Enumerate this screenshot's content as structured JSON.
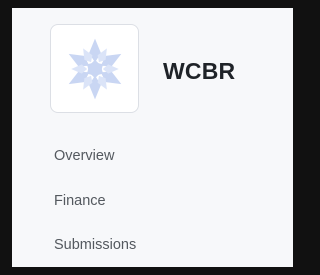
{
  "org": {
    "name": "WCBR",
    "logo_icon": "snowflake-icon",
    "logo_color": "#c9d6f3"
  },
  "nav": {
    "items": [
      {
        "label": "Overview"
      },
      {
        "label": "Finance"
      },
      {
        "label": "Submissions"
      }
    ]
  }
}
